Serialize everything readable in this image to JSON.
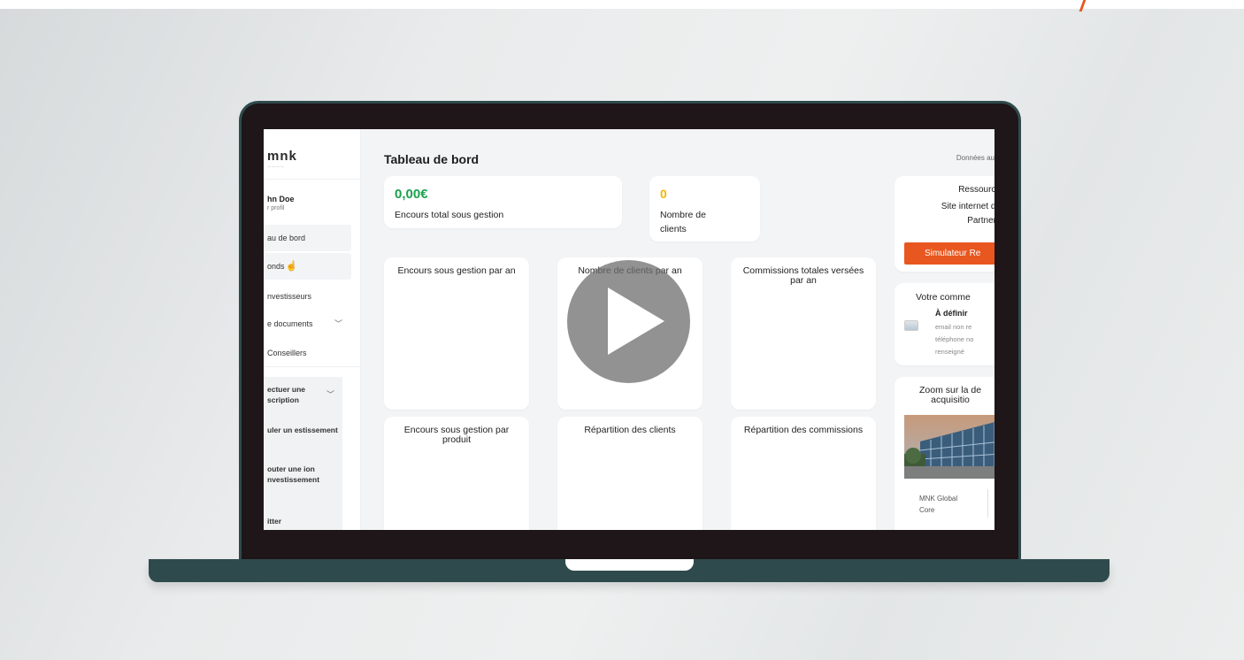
{
  "app": {
    "page_title": "Tableau de bord",
    "top_right": "Données au"
  },
  "sidebar": {
    "logo": "mnk",
    "logo_sub": "————",
    "user_name": "hn Doe",
    "user_sub": "r profil",
    "items": [
      {
        "label": "au de bord"
      },
      {
        "label": "onds"
      },
      {
        "label": "nvestisseurs"
      },
      {
        "label": "e documents"
      },
      {
        "label": "Conseillers"
      }
    ],
    "sub_items": [
      {
        "label": "ectuer une scription"
      },
      {
        "label": "uler un estissement"
      },
      {
        "label": "outer une ion nvestissement"
      },
      {
        "label": "itter"
      }
    ]
  },
  "kpis": [
    {
      "value": "0,00€",
      "label": "Encours total sous gestion",
      "color": "#1aa14d"
    },
    {
      "value": "0",
      "label": "Nombre de clients",
      "color": "#f2b705"
    }
  ],
  "charts": [
    {
      "title": "Encours sous gestion par an"
    },
    {
      "title": "Nombre de clients par an"
    },
    {
      "title": "Commissions totales versées par an"
    },
    {
      "title": "Encours sous gestion par produit"
    },
    {
      "title": "Répartition des clients"
    },
    {
      "title": "Répartition des commissions"
    }
  ],
  "resources": {
    "title": "Ressource",
    "link_line1": "Site internet de",
    "link_line2": "Partners",
    "button_label": "Simulateur Re"
  },
  "commercial": {
    "title": "Votre comme",
    "name": "À définir",
    "email": "email non re",
    "phone": "téléphone no",
    "phone2": "renseigné"
  },
  "zoom": {
    "title_line1": "Zoom sur la de",
    "title_line2": "acquisitio",
    "fund_line1": "MNK Global",
    "fund_line2": "Core"
  },
  "video": {
    "overlay": "play-icon"
  },
  "colors": {
    "accent": "#e8571f",
    "frame": "#2f4a4d",
    "green": "#1aa14d",
    "yellow": "#f2b705"
  }
}
